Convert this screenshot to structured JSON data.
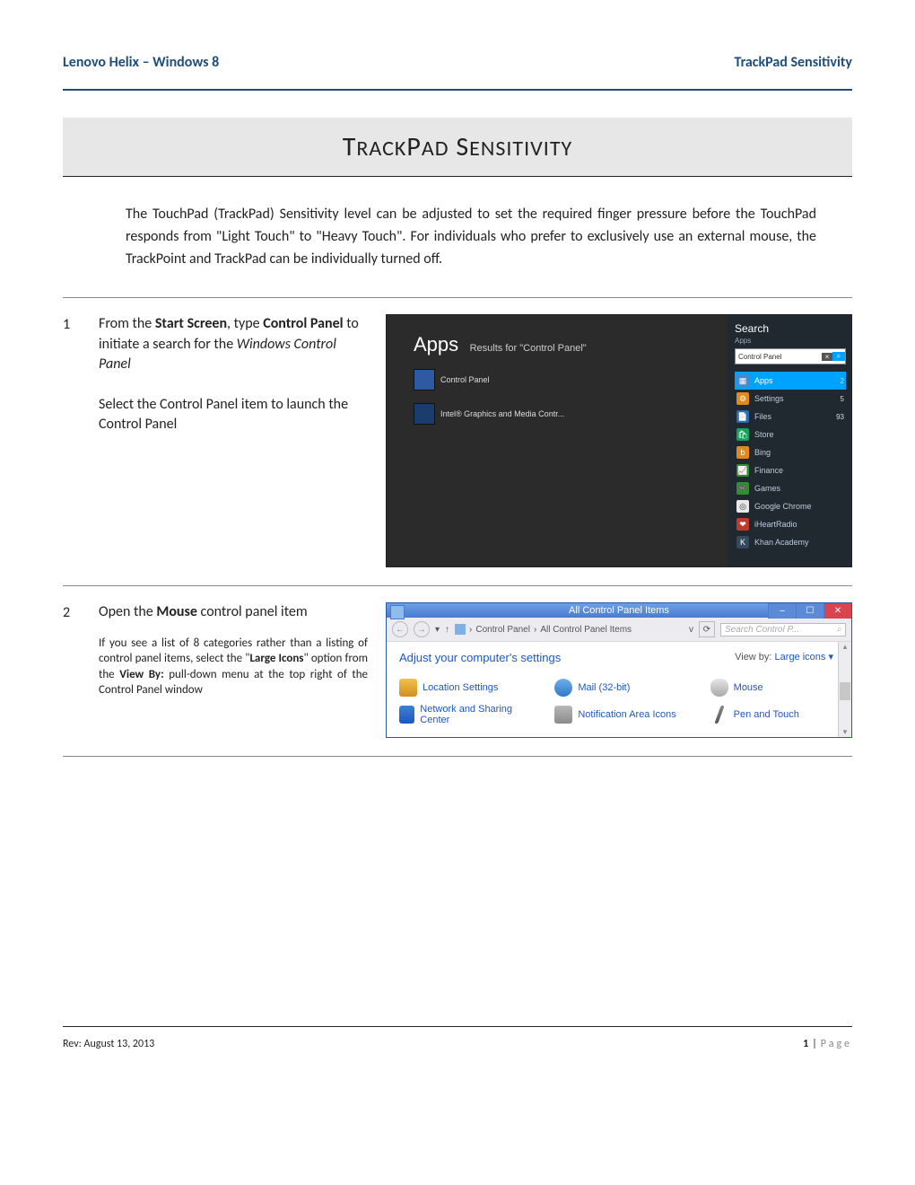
{
  "header": {
    "left": "Lenovo Helix – Windows 8",
    "right": "TrackPad Sensitivity"
  },
  "title": "TrackPad Sensitivity",
  "intro": "The TouchPad (TrackPad) Sensitivity level can be adjusted to set the required finger pressure before the TouchPad responds from \"Light Touch\" to \"Heavy Touch\".  For individuals who prefer to exclusively use an external mouse, the TrackPoint and TrackPad can be individually turned off.",
  "steps": {
    "s1": {
      "num": "1",
      "p1a": "From the ",
      "p1b": "Start Screen",
      "p1c": ", type ",
      "p1d": "Control Panel",
      "p1e": " to initiate a search for the ",
      "p1f": "Windows Control Panel",
      "p2": "Select the Control Panel item to launch the Control Panel"
    },
    "s2": {
      "num": "2",
      "p1a": "Open the ",
      "p1b": "Mouse",
      "p1c": " control panel item",
      "note_a": "If you see a list of 8 categories rather than a listing of control panel items, select the \"",
      "note_b": "Large Icons",
      "note_c": "\" option from the ",
      "note_d": "View By:",
      "note_e": " pull-down menu at the top right of the Control Panel window"
    }
  },
  "win8": {
    "apps_title": "Apps",
    "apps_sub": "Results for \"Control Panel\"",
    "tiles": {
      "cp": "Control Panel",
      "intel": "Intel® Graphics and Media Contr..."
    },
    "search": {
      "label": "Search",
      "context": "Apps",
      "value": "Control Panel",
      "clear": "×",
      "mag": "⌕"
    },
    "scopes": [
      {
        "name": "Apps",
        "count": "2",
        "cls": "apps"
      },
      {
        "name": "Settings",
        "count": "5",
        "cls": "settings"
      },
      {
        "name": "Files",
        "count": "93",
        "cls": "blue"
      },
      {
        "name": "Store",
        "count": "",
        "cls": "store"
      },
      {
        "name": "Bing",
        "count": "",
        "cls": "orange"
      },
      {
        "name": "Finance",
        "count": "",
        "cls": "green"
      },
      {
        "name": "Games",
        "count": "",
        "cls": "green"
      },
      {
        "name": "Google Chrome",
        "count": "",
        "cls": "chrome"
      },
      {
        "name": "iHeartRadio",
        "count": "",
        "cls": "red"
      },
      {
        "name": "Khan Academy",
        "count": "",
        "cls": "purple"
      }
    ]
  },
  "cp": {
    "title": "All Control Panel Items",
    "path1": "Control Panel",
    "path2": "All Control Panel Items",
    "search_placeholder": "Search Control P...",
    "heading": "Adjust your computer's settings",
    "viewby_label": "View by:",
    "viewby_value": "Large icons ▾",
    "items": {
      "loc": "Location Settings",
      "mail": "Mail (32-bit)",
      "mouse": "Mouse",
      "net": "Network and Sharing Center",
      "notif": "Notification Area Icons",
      "pen": "Pen and Touch"
    },
    "winbtns": {
      "min": "–",
      "max": "☐",
      "close": "✕"
    }
  },
  "footer": {
    "rev": "Rev: August 13, 2013",
    "page_num": "1",
    "page_sep": "|",
    "page_label": "Page"
  }
}
